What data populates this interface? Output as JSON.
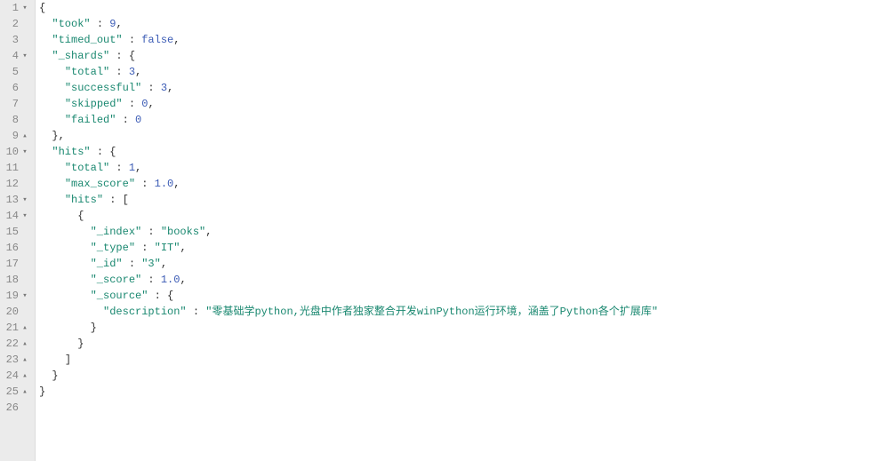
{
  "lines": [
    {
      "n": 1,
      "fold": "open",
      "tokens": [
        [
          "punc",
          "{"
        ]
      ]
    },
    {
      "n": 2,
      "fold": "",
      "tokens": [
        [
          "ws",
          "  "
        ],
        [
          "key",
          "\"took\""
        ],
        [
          "punc",
          " : "
        ],
        [
          "num",
          "9"
        ],
        [
          "punc",
          ","
        ]
      ]
    },
    {
      "n": 3,
      "fold": "",
      "tokens": [
        [
          "ws",
          "  "
        ],
        [
          "key",
          "\"timed_out\""
        ],
        [
          "punc",
          " : "
        ],
        [
          "bool",
          "false"
        ],
        [
          "punc",
          ","
        ]
      ]
    },
    {
      "n": 4,
      "fold": "open",
      "tokens": [
        [
          "ws",
          "  "
        ],
        [
          "key",
          "\"_shards\""
        ],
        [
          "punc",
          " : {"
        ]
      ]
    },
    {
      "n": 5,
      "fold": "",
      "tokens": [
        [
          "ws",
          "    "
        ],
        [
          "key",
          "\"total\""
        ],
        [
          "punc",
          " : "
        ],
        [
          "num",
          "3"
        ],
        [
          "punc",
          ","
        ]
      ]
    },
    {
      "n": 6,
      "fold": "",
      "tokens": [
        [
          "ws",
          "    "
        ],
        [
          "key",
          "\"successful\""
        ],
        [
          "punc",
          " : "
        ],
        [
          "num",
          "3"
        ],
        [
          "punc",
          ","
        ]
      ]
    },
    {
      "n": 7,
      "fold": "",
      "tokens": [
        [
          "ws",
          "    "
        ],
        [
          "key",
          "\"skipped\""
        ],
        [
          "punc",
          " : "
        ],
        [
          "num",
          "0"
        ],
        [
          "punc",
          ","
        ]
      ]
    },
    {
      "n": 8,
      "fold": "",
      "tokens": [
        [
          "ws",
          "    "
        ],
        [
          "key",
          "\"failed\""
        ],
        [
          "punc",
          " : "
        ],
        [
          "num",
          "0"
        ]
      ]
    },
    {
      "n": 9,
      "fold": "close",
      "tokens": [
        [
          "ws",
          "  "
        ],
        [
          "punc",
          "},"
        ]
      ]
    },
    {
      "n": 10,
      "fold": "open",
      "tokens": [
        [
          "ws",
          "  "
        ],
        [
          "key",
          "\"hits\""
        ],
        [
          "punc",
          " : {"
        ]
      ]
    },
    {
      "n": 11,
      "fold": "",
      "tokens": [
        [
          "ws",
          "    "
        ],
        [
          "key",
          "\"total\""
        ],
        [
          "punc",
          " : "
        ],
        [
          "num",
          "1"
        ],
        [
          "punc",
          ","
        ]
      ]
    },
    {
      "n": 12,
      "fold": "",
      "tokens": [
        [
          "ws",
          "    "
        ],
        [
          "key",
          "\"max_score\""
        ],
        [
          "punc",
          " : "
        ],
        [
          "num",
          "1.0"
        ],
        [
          "punc",
          ","
        ]
      ]
    },
    {
      "n": 13,
      "fold": "open",
      "tokens": [
        [
          "ws",
          "    "
        ],
        [
          "key",
          "\"hits\""
        ],
        [
          "punc",
          " : ["
        ]
      ]
    },
    {
      "n": 14,
      "fold": "open",
      "tokens": [
        [
          "ws",
          "      "
        ],
        [
          "punc",
          "{"
        ]
      ]
    },
    {
      "n": 15,
      "fold": "",
      "tokens": [
        [
          "ws",
          "        "
        ],
        [
          "key",
          "\"_index\""
        ],
        [
          "punc",
          " : "
        ],
        [
          "str",
          "\"books\""
        ],
        [
          "punc",
          ","
        ]
      ]
    },
    {
      "n": 16,
      "fold": "",
      "tokens": [
        [
          "ws",
          "        "
        ],
        [
          "key",
          "\"_type\""
        ],
        [
          "punc",
          " : "
        ],
        [
          "str",
          "\"IT\""
        ],
        [
          "punc",
          ","
        ]
      ]
    },
    {
      "n": 17,
      "fold": "",
      "tokens": [
        [
          "ws",
          "        "
        ],
        [
          "key",
          "\"_id\""
        ],
        [
          "punc",
          " : "
        ],
        [
          "str",
          "\"3\""
        ],
        [
          "punc",
          ","
        ]
      ]
    },
    {
      "n": 18,
      "fold": "",
      "tokens": [
        [
          "ws",
          "        "
        ],
        [
          "key",
          "\"_score\""
        ],
        [
          "punc",
          " : "
        ],
        [
          "num",
          "1.0"
        ],
        [
          "punc",
          ","
        ]
      ]
    },
    {
      "n": 19,
      "fold": "open",
      "tokens": [
        [
          "ws",
          "        "
        ],
        [
          "key",
          "\"_source\""
        ],
        [
          "punc",
          " : {"
        ]
      ]
    },
    {
      "n": 20,
      "fold": "",
      "tokens": [
        [
          "ws",
          "          "
        ],
        [
          "key",
          "\"description\""
        ],
        [
          "punc",
          " : "
        ],
        [
          "str",
          "\"零基础学python,光盘中作者独家整合开发winPython运行环境，涵盖了Python各个扩展库\""
        ]
      ]
    },
    {
      "n": 21,
      "fold": "close",
      "tokens": [
        [
          "ws",
          "        "
        ],
        [
          "punc",
          "}"
        ]
      ]
    },
    {
      "n": 22,
      "fold": "close",
      "tokens": [
        [
          "ws",
          "      "
        ],
        [
          "punc",
          "}"
        ]
      ]
    },
    {
      "n": 23,
      "fold": "close",
      "tokens": [
        [
          "ws",
          "    "
        ],
        [
          "punc",
          "]"
        ]
      ]
    },
    {
      "n": 24,
      "fold": "close",
      "tokens": [
        [
          "ws",
          "  "
        ],
        [
          "punc",
          "}"
        ]
      ]
    },
    {
      "n": 25,
      "fold": "close",
      "tokens": [
        [
          "punc",
          "}"
        ]
      ]
    },
    {
      "n": 26,
      "fold": "",
      "tokens": []
    }
  ],
  "foldGlyphs": {
    "open": "▾",
    "close": "▴"
  }
}
